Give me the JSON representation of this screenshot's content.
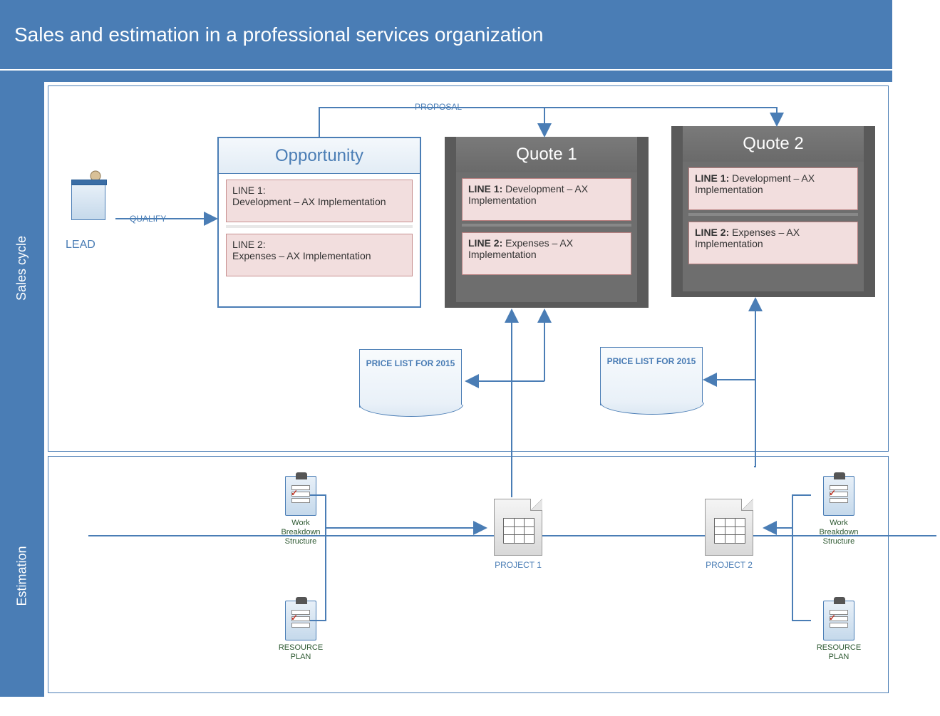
{
  "title": "Sales and estimation in a professional services organization",
  "swimlanes": {
    "sales": "Sales cycle",
    "estimation": "Estimation"
  },
  "lead": {
    "label": "LEAD"
  },
  "flows": {
    "qualify": "QUALIFY",
    "proposal": "PROPOSAL"
  },
  "opportunity": {
    "title": "Opportunity",
    "line1_label": "LINE 1:",
    "line1_desc": "Development – AX Implementation",
    "line2_label": "LINE 2:",
    "line2_desc": "Expenses – AX Implementation"
  },
  "quote1": {
    "title": "Quote 1",
    "line1_label": "LINE 1:",
    "line1_desc": "Development – AX Implementation",
    "line2_label": "LINE 2:",
    "line2_desc": "Expenses – AX Implementation"
  },
  "quote2": {
    "title": "Quote 2",
    "line1_label": "LINE 1:",
    "line1_desc": "Development – AX Implementation",
    "line2_label": "LINE 2:",
    "line2_desc": "Expenses – AX Implementation"
  },
  "pricelist": {
    "text": "PRICE LIST FOR 2015"
  },
  "project1": {
    "label": "PROJECT 1"
  },
  "project2": {
    "label": "PROJECT 2"
  },
  "wbs": {
    "label": "Work Breakdown Structure"
  },
  "resplan": {
    "label": "RESOURCE PLAN"
  }
}
